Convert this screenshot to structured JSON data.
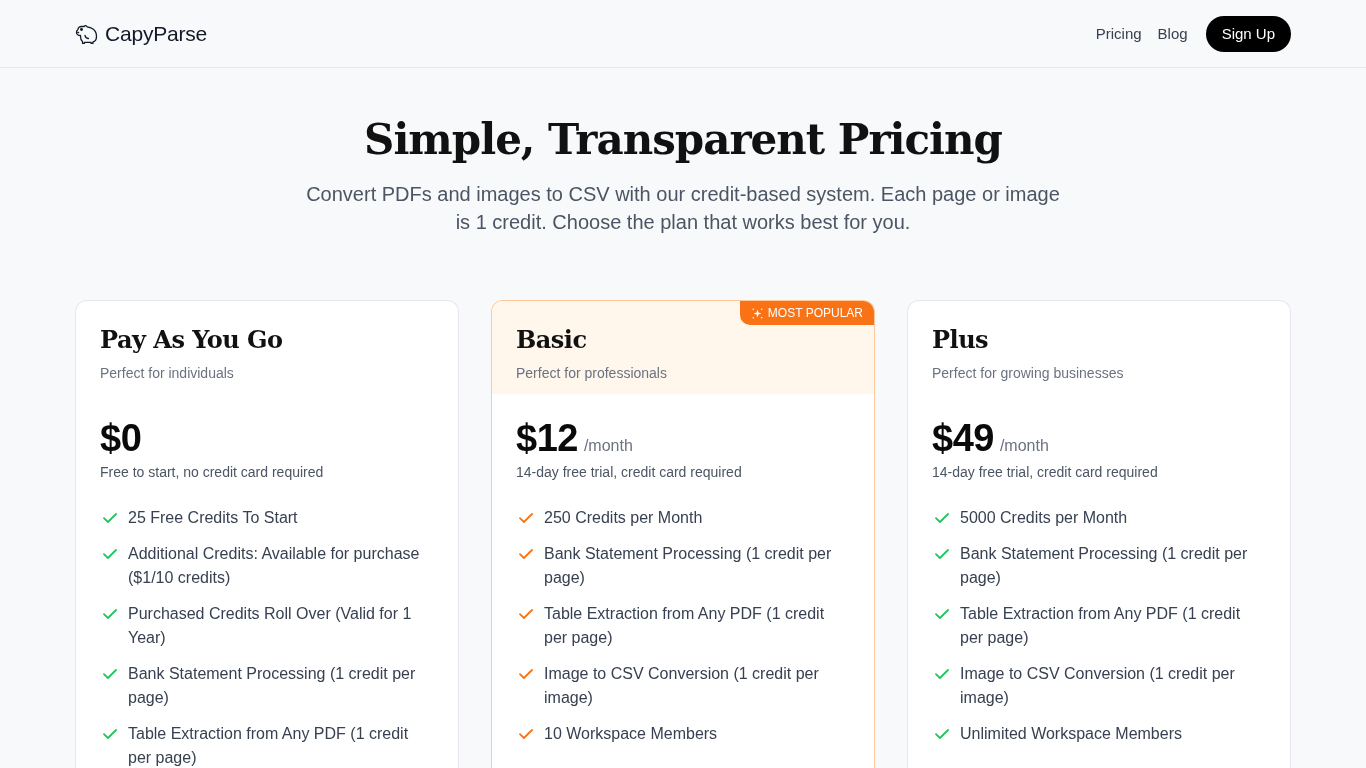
{
  "header": {
    "logo": "CapyParse",
    "nav": [
      {
        "label": "Pricing"
      },
      {
        "label": "Blog"
      }
    ],
    "cta": "Sign Up"
  },
  "hero": {
    "title": "Simple, Transparent Pricing",
    "subtitle": "Convert PDFs and images to CSV with our credit-based system. Each page or image is 1 credit. Choose the plan that works best for you."
  },
  "plans": [
    {
      "name": "Pay As You Go",
      "tagline": "Perfect for individuals",
      "price": "$0",
      "note": "Free to start, no credit card required",
      "highlighted": false,
      "features": [
        "25 Free Credits To Start",
        "Additional Credits: Available for purchase ($1/10 credits)",
        "Purchased Credits Roll Over (Valid for 1 Year)",
        "Bank Statement Processing (1 credit per page)",
        "Table Extraction from Any PDF (1 credit per page)"
      ]
    },
    {
      "name": "Basic",
      "tagline": "Perfect for professionals",
      "price": "$12",
      "period": "/month",
      "note": "14-day free trial, credit card required",
      "highlighted": true,
      "badge": "MOST POPULAR",
      "features": [
        "250 Credits per Month",
        "Bank Statement Processing (1 credit per page)",
        "Table Extraction from Any PDF (1 credit per page)",
        "Image to CSV Conversion (1 credit per image)",
        "10 Workspace Members"
      ]
    },
    {
      "name": "Plus",
      "tagline": "Perfect for growing businesses",
      "price": "$49",
      "period": "/month",
      "note": "14-day free trial, credit card required",
      "highlighted": false,
      "features": [
        "5000 Credits per Month",
        "Bank Statement Processing (1 credit per page)",
        "Table Extraction from Any PDF (1 credit per page)",
        "Image to CSV Conversion (1 credit per image)",
        "Unlimited Workspace Members"
      ]
    }
  ]
}
